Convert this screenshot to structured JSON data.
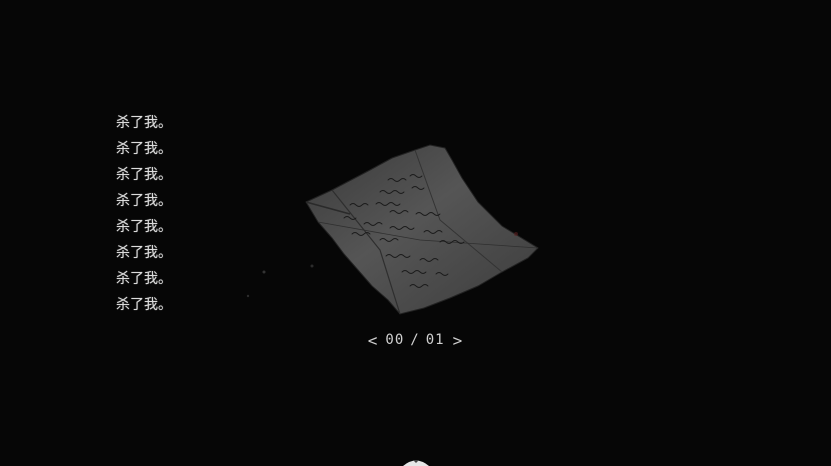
{
  "text_lines": [
    "杀了我。",
    "杀了我。",
    "杀了我。",
    "杀了我。",
    "杀了我。",
    "杀了我。",
    "杀了我。",
    "杀了我。"
  ],
  "pager": {
    "prev_icon": "chevron-left-icon",
    "prev_glyph": "<",
    "current": "00",
    "separator": "/",
    "total": "01",
    "next_icon": "chevron-right-icon",
    "next_glyph": ">"
  },
  "item": {
    "icon": "crumpled-note-icon"
  },
  "bottom_indicator": {
    "icon": "triangle-down-icon"
  },
  "colors": {
    "background": "#060606",
    "text": "#dcdcdc",
    "paper": "#4a4a4a",
    "ink": "#1a1a1a"
  }
}
